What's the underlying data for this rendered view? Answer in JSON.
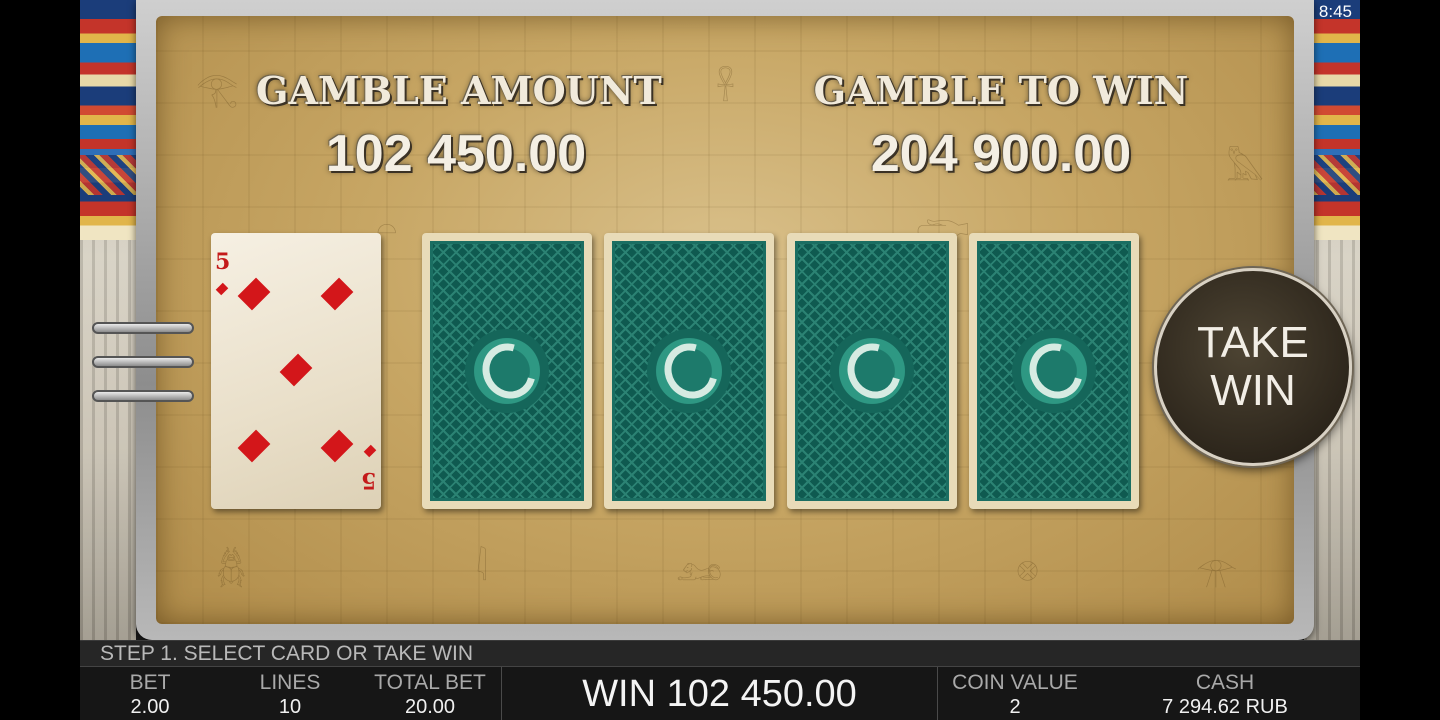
{
  "system": {
    "time": "8:45"
  },
  "gamble": {
    "amount_label": "GAMBLE AMOUNT",
    "amount_value": "102 450.00",
    "to_win_label": "GAMBLE TO WIN",
    "to_win_value": "204 900.00"
  },
  "cards": {
    "dealer": {
      "rank": "5",
      "suit": "diamonds"
    },
    "face_down_count": 4
  },
  "take_win": {
    "line1": "TAKE",
    "line2": "WIN"
  },
  "status": {
    "message": "STEP 1. SELECT CARD OR TAKE WIN"
  },
  "bottom_bar": {
    "bet": {
      "label": "BET",
      "value": "2.00"
    },
    "lines": {
      "label": "LINES",
      "value": "10"
    },
    "total_bet": {
      "label": "TOTAL BET",
      "value": "20.00"
    },
    "win_text": "WIN 102 450.00",
    "coin_value": {
      "label": "COIN VALUE",
      "value": "2"
    },
    "cash": {
      "label": "CASH",
      "value": "7 294.62 RUB"
    }
  },
  "colors": {
    "card_back": "#0f5a50",
    "pip_red": "#d3161a",
    "board_gold": "#c7a664"
  },
  "icons": {
    "menu": "hamburger-menu-icon",
    "card_emblem": "crescent-emblem-icon"
  }
}
